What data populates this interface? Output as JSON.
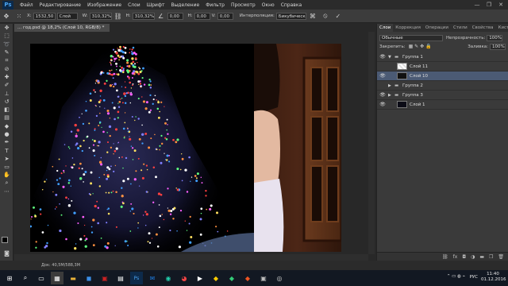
{
  "menubar": {
    "logo": "Ps",
    "items": [
      "Файл",
      "Редактирование",
      "Изображение",
      "Слои",
      "Шрифт",
      "Выделение",
      "Фильтр",
      "Просмотр",
      "Окно",
      "Справка"
    ],
    "minimize": "—",
    "maximize": "❐",
    "close": "✕"
  },
  "options": {
    "x_value": "1532,50",
    "x_unit": "Слой",
    "w_value": "310,32%",
    "h_value": "310,32%",
    "angle": "0,00",
    "h_skew": "0,00",
    "v_skew": "0,00",
    "interpolation_label": "Интерполяция:",
    "interpolation_value": "Бикубическ...",
    "cancel_icon": "⦸",
    "commit_icon": "✓"
  },
  "document": {
    "tab_label": "... год.psd @ 18,2% (Слой 10, RGB/8) *",
    "status": "Док: 40,5M/588,3M"
  },
  "panel": {
    "tabs": [
      "Слои",
      "Коррекция",
      "Операции",
      "Стили",
      "Свойства",
      "Кисть"
    ],
    "blend_mode": "Обычные",
    "opacity_label": "Непрозрачность:",
    "opacity_value": "100%",
    "lock_label": "Закрепить:",
    "fill_label": "Заливка:",
    "fill_value": "100%",
    "layers": [
      {
        "name": "Группа 1",
        "type": "group",
        "visible": true,
        "selected": false
      },
      {
        "name": "Слой 11",
        "type": "layer",
        "visible": false,
        "selected": false
      },
      {
        "name": "Слой 10",
        "type": "layer",
        "visible": true,
        "selected": true
      },
      {
        "name": "Группа 2",
        "type": "group",
        "visible": false,
        "selected": false
      },
      {
        "name": "Группа 3",
        "type": "group",
        "visible": true,
        "selected": false
      },
      {
        "name": "Слой 1",
        "type": "layer",
        "visible": true,
        "selected": false
      }
    ]
  },
  "taskbar": {
    "language": "РУС",
    "time": "11:40",
    "date": "01.12.2016"
  },
  "colors": {
    "selected_layer": "#4b5a74",
    "ps_blue": "#4aa3f0"
  }
}
